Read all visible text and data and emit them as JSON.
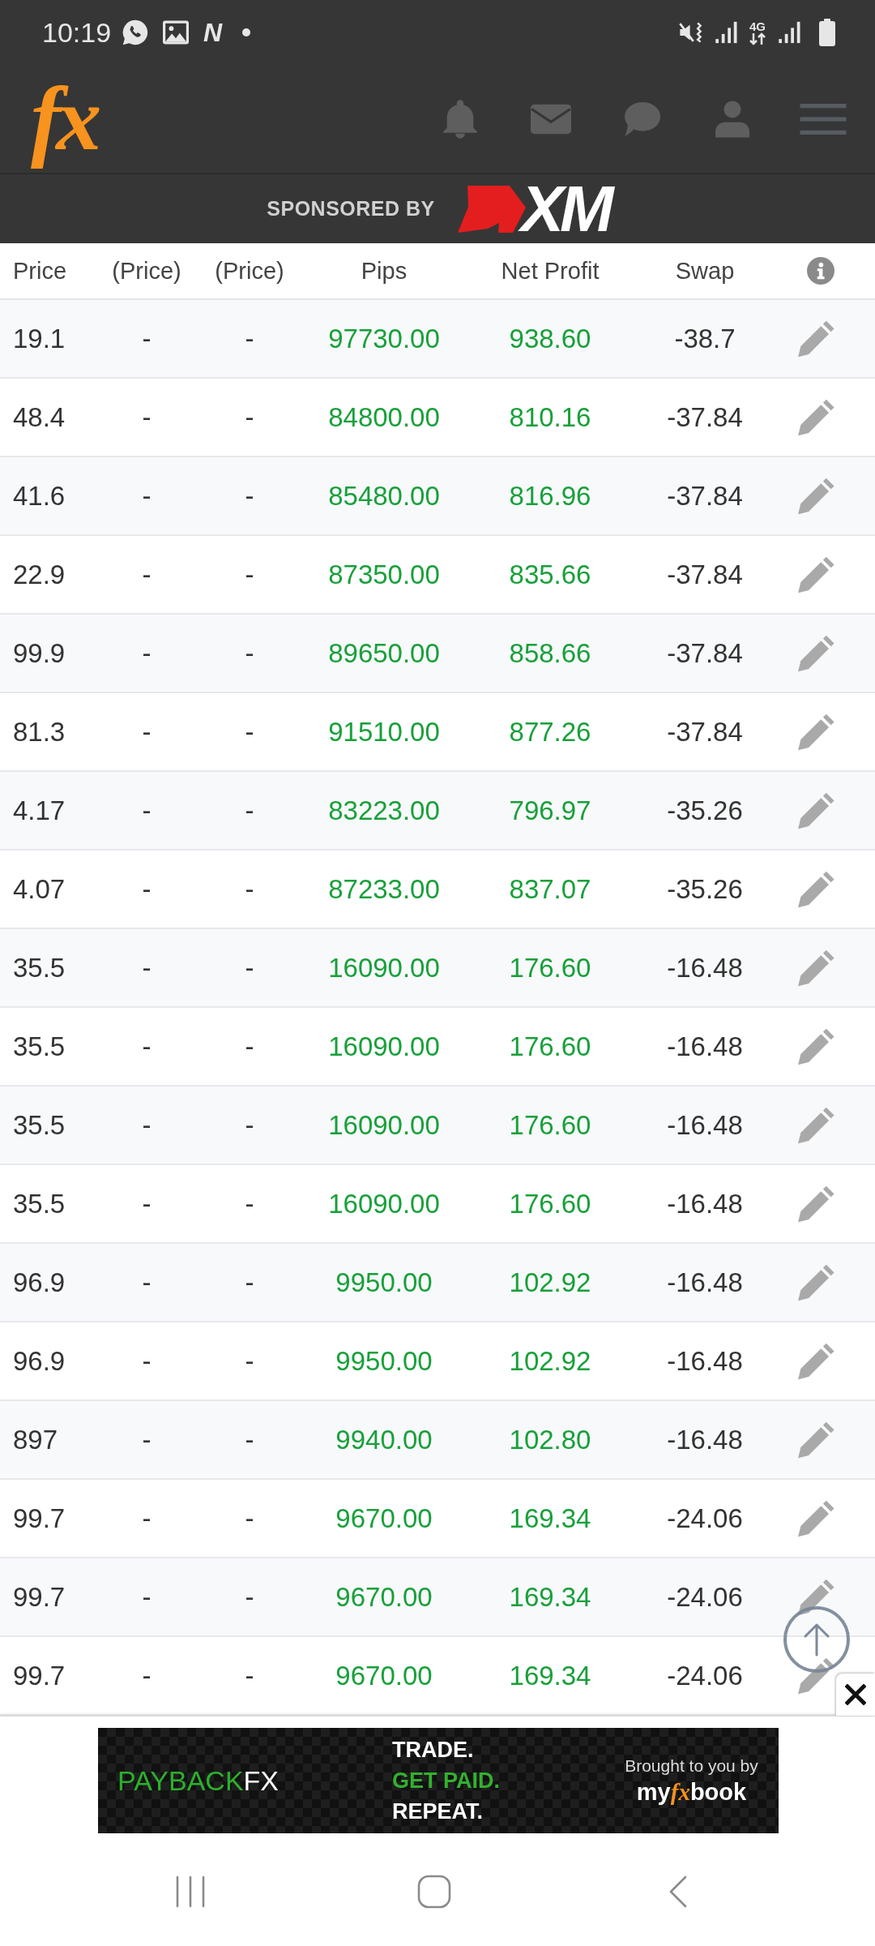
{
  "status_bar": {
    "time": "10:19",
    "app_letter": "N",
    "network": "4G"
  },
  "header": {
    "logo": "fx",
    "sponsor_label": "SPONSORED BY",
    "sponsor_name": "XM"
  },
  "table": {
    "columns": [
      {
        "label": "Price",
        "kind": "price"
      },
      {
        "label": "(Price)",
        "kind": "price"
      },
      {
        "label": "(Price)",
        "kind": "price"
      },
      {
        "label": "Pips",
        "kind": "gain"
      },
      {
        "label": "Net Profit",
        "kind": "gain"
      },
      {
        "label": "Swap",
        "kind": "price"
      }
    ],
    "rows": [
      [
        "19.1",
        "-",
        "-",
        "97730.00",
        "938.60",
        "-38.7"
      ],
      [
        "48.4",
        "-",
        "-",
        "84800.00",
        "810.16",
        "-37.84"
      ],
      [
        "41.6",
        "-",
        "-",
        "85480.00",
        "816.96",
        "-37.84"
      ],
      [
        "22.9",
        "-",
        "-",
        "87350.00",
        "835.66",
        "-37.84"
      ],
      [
        "99.9",
        "-",
        "-",
        "89650.00",
        "858.66",
        "-37.84"
      ],
      [
        "81.3",
        "-",
        "-",
        "91510.00",
        "877.26",
        "-37.84"
      ],
      [
        "4.17",
        "-",
        "-",
        "83223.00",
        "796.97",
        "-35.26"
      ],
      [
        "4.07",
        "-",
        "-",
        "87233.00",
        "837.07",
        "-35.26"
      ],
      [
        "35.5",
        "-",
        "-",
        "16090.00",
        "176.60",
        "-16.48"
      ],
      [
        "35.5",
        "-",
        "-",
        "16090.00",
        "176.60",
        "-16.48"
      ],
      [
        "35.5",
        "-",
        "-",
        "16090.00",
        "176.60",
        "-16.48"
      ],
      [
        "35.5",
        "-",
        "-",
        "16090.00",
        "176.60",
        "-16.48"
      ],
      [
        "96.9",
        "-",
        "-",
        "9950.00",
        "102.92",
        "-16.48"
      ],
      [
        "96.9",
        "-",
        "-",
        "9950.00",
        "102.92",
        "-16.48"
      ],
      [
        "897",
        "-",
        "-",
        "9940.00",
        "102.80",
        "-16.48"
      ],
      [
        "99.7",
        "-",
        "-",
        "9670.00",
        "169.34",
        "-24.06"
      ],
      [
        "99.7",
        "-",
        "-",
        "9670.00",
        "169.34",
        "-24.06"
      ],
      [
        "99.7",
        "-",
        "-",
        "9670.00",
        "169.34",
        "-24.06"
      ]
    ]
  },
  "ad": {
    "brand": {
      "main": "PAYBACK",
      "accent": "FX"
    },
    "taglines": [
      {
        "text": "TRADE.",
        "color": "#ffffff"
      },
      {
        "text": "GET PAID.",
        "color": "#33b02e"
      },
      {
        "text": "REPEAT.",
        "color": "#ffffff"
      }
    ],
    "credit": "Brought to you by",
    "credit_brand": {
      "pre": "my",
      "accent": "fx",
      "post": "book"
    }
  }
}
